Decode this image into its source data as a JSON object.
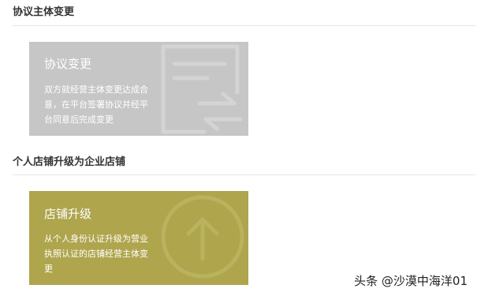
{
  "sections": [
    {
      "title": "协议主体变更",
      "card": {
        "title": "协议变更",
        "description": "双方就经营主体变更达成合意，在平台签署协议并经平台同意后完成变更",
        "icon": "document-transfer-icon",
        "color": "#c6c6c6"
      }
    },
    {
      "title": "个人店铺升级为企业店铺",
      "card": {
        "title": "店铺升级",
        "description": "从个人身份认证升级为营业执照认证的店铺经营主体变更",
        "icon": "arrow-up-circle-icon",
        "color": "#aea54d"
      }
    }
  ],
  "watermark": "头条 @沙漠中海洋01"
}
